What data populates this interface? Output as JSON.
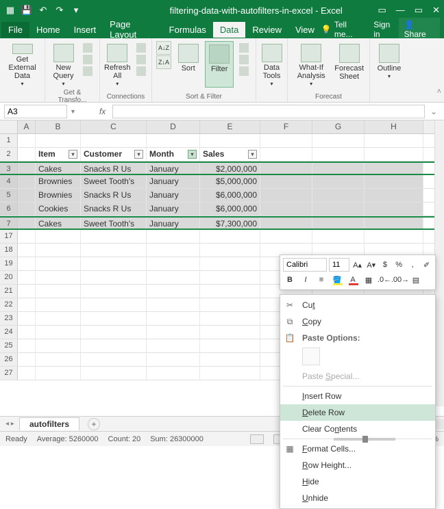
{
  "app": {
    "title": "filtering-data-with-autofilters-in-excel - Excel"
  },
  "qat": {
    "save": "💾",
    "undo": "↶",
    "redo": "↷"
  },
  "window": {
    "help": "?",
    "min": "—",
    "max": "▭",
    "close": "✕"
  },
  "menu": {
    "file": "File",
    "home": "Home",
    "insert": "Insert",
    "pageLayout": "Page Layout",
    "formulas": "Formulas",
    "data": "Data",
    "review": "Review",
    "view": "View",
    "tellme": "Tell me...",
    "signin": "Sign in",
    "share": "Share"
  },
  "ribbon": {
    "getExternal": "Get External Data",
    "getExternalShort": "Get External",
    "newQuery": "New Query",
    "getTransform": "Get & Transfo...",
    "refreshAll": "Refresh All",
    "connections": "Connections",
    "sort": "Sort",
    "filter": "Filter",
    "clear": "Clear",
    "reapply": "Reapply",
    "advanced": "Advanced",
    "sortFilter": "Sort & Filter",
    "dataTools": "Data Tools",
    "whatIf": "What-If Analysis",
    "forecastSheet": "Forecast Sheet",
    "forecast": "Forecast",
    "outline": "Outline"
  },
  "namebox": "A3",
  "columns": [
    "A",
    "B",
    "C",
    "D",
    "E",
    "F",
    "G",
    "H"
  ],
  "headers": {
    "item": "Item",
    "customer": "Customer",
    "month": "Month",
    "sales": "Sales"
  },
  "rows": [
    {
      "num": 3,
      "item": "Cakes",
      "customer": "Snacks R Us",
      "month": "January",
      "sales": "$2,000,000"
    },
    {
      "num": 4,
      "item": "Brownies",
      "customer": "Sweet Tooth's",
      "month": "January",
      "sales": "$5,000,000"
    },
    {
      "num": 5,
      "item": "Brownies",
      "customer": "Snacks R Us",
      "month": "January",
      "sales": "$6,000,000"
    },
    {
      "num": 6,
      "item": "Cookies",
      "customer": "Snacks R Us",
      "month": "January",
      "sales": "$6,000,000"
    },
    {
      "num": 7,
      "item": "Cakes",
      "customer": "Sweet Tooth's",
      "month": "January",
      "sales": "$7,300,000"
    }
  ],
  "blankRows": [
    17,
    18,
    19,
    20,
    21,
    22,
    23,
    24,
    25,
    26,
    27
  ],
  "miniToolbar": {
    "font": "Calibri",
    "size": "11",
    "bold": "B",
    "italic": "I"
  },
  "ctx": {
    "cut": "Cut",
    "copy": "Copy",
    "pasteOptions": "Paste Options:",
    "pasteSpecial": "Paste Special...",
    "insertRow": "Insert Row",
    "deleteRow": "Delete Row",
    "clearContents": "Clear Contents",
    "formatCells": "Format Cells...",
    "rowHeight": "Row Height...",
    "hide": "Hide",
    "unhide": "Unhide"
  },
  "sheet": {
    "name": "autofilters",
    "add": "+"
  },
  "status": {
    "ready": "Ready",
    "average": "Average: 5260000",
    "count": "Count: 20",
    "sum": "Sum: 26300000",
    "zoom": "100%"
  }
}
